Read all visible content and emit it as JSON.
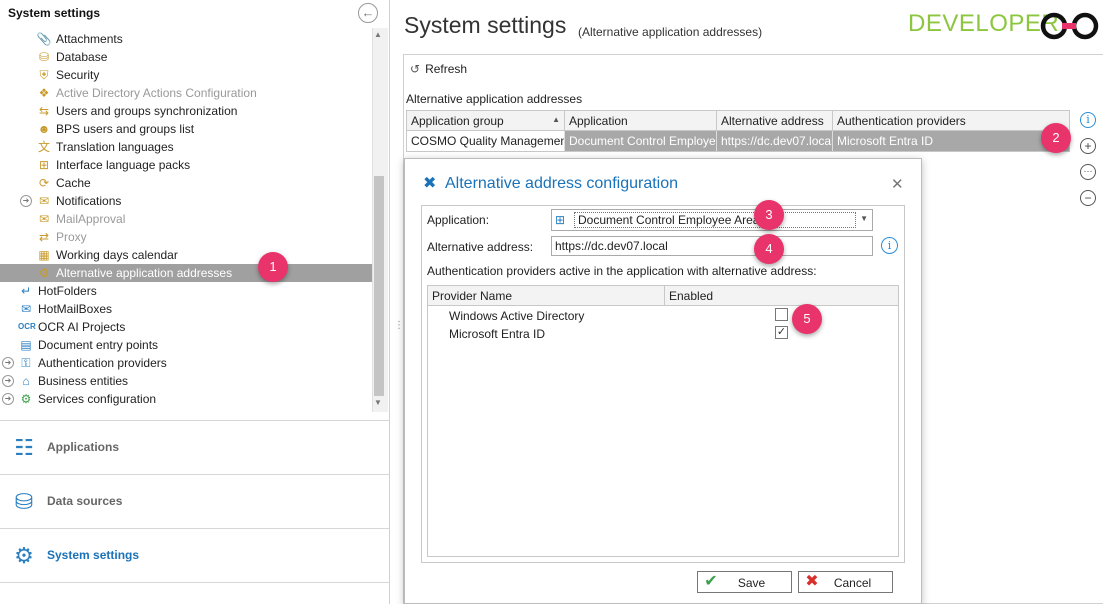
{
  "left_panel": {
    "header": "System settings",
    "tree": [
      {
        "label": "Attachments",
        "icon": "paperclip-icon",
        "dimmed": false
      },
      {
        "label": "Database",
        "icon": "database-icon",
        "dimmed": false
      },
      {
        "label": "Security",
        "icon": "shield-icon",
        "dimmed": false
      },
      {
        "label": "Active Directory Actions Configuration",
        "icon": "network-icon",
        "dimmed": true
      },
      {
        "label": "Users and groups synchronization",
        "icon": "sync-icon",
        "dimmed": false
      },
      {
        "label": "BPS users and groups list",
        "icon": "users-icon",
        "dimmed": false
      },
      {
        "label": "Translation languages",
        "icon": "translate-icon",
        "dimmed": false
      },
      {
        "label": "Interface language packs",
        "icon": "language-pack-icon",
        "dimmed": false
      },
      {
        "label": "Cache",
        "icon": "cache-icon",
        "dimmed": false
      },
      {
        "label": "Notifications",
        "icon": "envelope-icon",
        "dimmed": false
      },
      {
        "label": "MailApproval",
        "icon": "mail-approval-icon",
        "dimmed": true
      },
      {
        "label": "Proxy",
        "icon": "proxy-icon",
        "dimmed": true
      },
      {
        "label": "Working days calendar",
        "icon": "calendar-icon",
        "dimmed": false
      },
      {
        "label": "Alternative application addresses",
        "icon": "globe-gear-icon",
        "dimmed": false
      },
      {
        "label": "HotFolders",
        "icon": "hotfolder-icon",
        "dimmed": false
      },
      {
        "label": "HotMailBoxes",
        "icon": "hotmailbox-icon",
        "dimmed": false
      },
      {
        "label": "OCR AI Projects",
        "icon": "ocr-icon",
        "dimmed": false
      },
      {
        "label": "Document entry points",
        "icon": "document-icon",
        "dimmed": false
      },
      {
        "label": "Authentication providers",
        "icon": "key-users-icon",
        "dimmed": false
      },
      {
        "label": "Business entities",
        "icon": "home-icon",
        "dimmed": false
      },
      {
        "label": "Services configuration",
        "icon": "services-gear-icon",
        "dimmed": false
      }
    ],
    "nav": [
      {
        "label": "Applications",
        "icon": "applications-icon"
      },
      {
        "label": "Data sources",
        "icon": "data-sources-icon"
      },
      {
        "label": "System settings",
        "icon": "system-settings-icon"
      }
    ]
  },
  "page": {
    "title": "System settings",
    "subtitle": "(Alternative application addresses)",
    "brand": "DEVELOPER",
    "refresh_label": "Refresh",
    "grid_title": "Alternative application addresses"
  },
  "grid": {
    "columns": [
      "Application group",
      "Application",
      "Alternative address",
      "Authentication providers"
    ],
    "rows": [
      [
        "COSMO Quality Management",
        "Document Control Employe...",
        "https://dc.dev07.local",
        "Microsoft Entra ID"
      ]
    ]
  },
  "dialog": {
    "title": "Alternative address configuration",
    "application_label": "Application:",
    "application_value": "Document Control Employee Area",
    "alt_address_label": "Alternative address:",
    "alt_address_value": "https://dc.dev07.local",
    "providers_caption": "Authentication providers active in the application with alternative address:",
    "provider_columns": [
      "Provider Name",
      "Enabled"
    ],
    "providers": [
      {
        "name": "Windows Active Directory",
        "enabled": false
      },
      {
        "name": "Microsoft Entra ID",
        "enabled": true
      }
    ],
    "save_label": "Save",
    "cancel_label": "Cancel"
  },
  "badges": [
    "1",
    "2",
    "3",
    "4",
    "5"
  ],
  "colors": {
    "accent": "#1a72b8",
    "brand_green": "#8cc63f",
    "badge": "#e8336b",
    "selection": "#a0a0a0"
  }
}
